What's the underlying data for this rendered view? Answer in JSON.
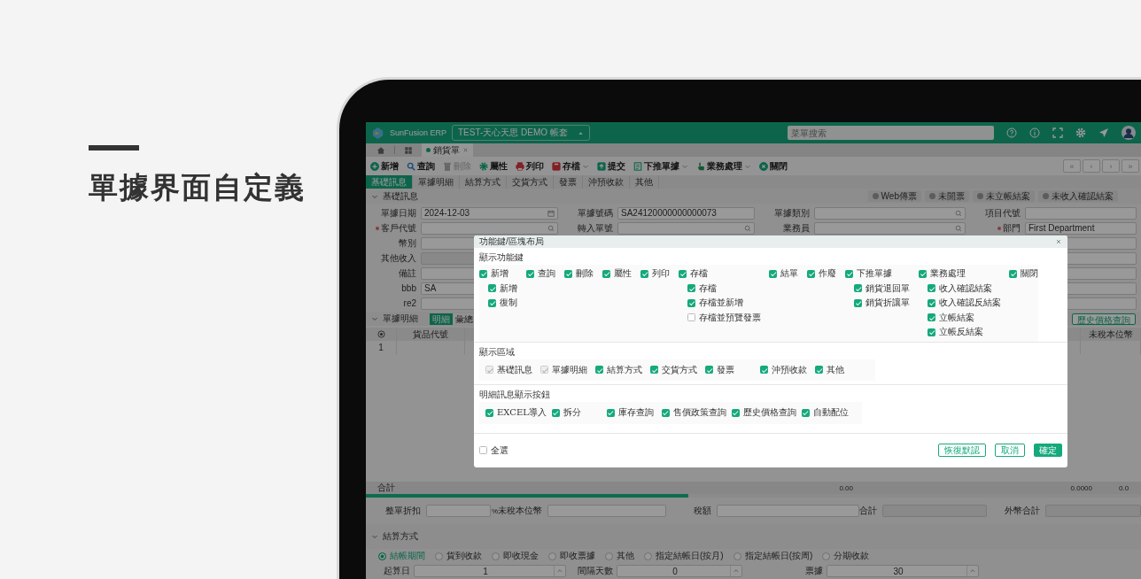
{
  "page": {
    "heading": "單據界面自定義"
  },
  "app": {
    "brand": "SunFusion ERP",
    "account": "TEST-天心天思 DEMO 帳套",
    "search": {
      "placeholder": "菜單搜索"
    },
    "doc_tabs": [
      {
        "label": "銷貨單",
        "selected": true
      }
    ],
    "toolbar": [
      {
        "label": "新增",
        "disabled": false,
        "dropdown": false
      },
      {
        "label": "查詢",
        "disabled": false,
        "dropdown": false
      },
      {
        "label": "刪除",
        "disabled": true,
        "dropdown": false
      },
      {
        "label": "屬性",
        "disabled": false,
        "dropdown": false
      },
      {
        "label": "列印",
        "disabled": false,
        "dropdown": false
      },
      {
        "label": "存檔",
        "disabled": false,
        "dropdown": true
      },
      {
        "label": "提交",
        "disabled": false,
        "dropdown": false
      },
      {
        "label": "下推單據",
        "disabled": false,
        "dropdown": true
      },
      {
        "label": "業務處理",
        "disabled": false,
        "dropdown": true
      },
      {
        "label": "關閉",
        "disabled": false,
        "dropdown": false
      }
    ],
    "pager": [
      "«",
      "‹",
      "›",
      "»"
    ],
    "section_tabs": [
      {
        "label": "基礎訊息",
        "selected": true
      },
      {
        "label": "單據明細",
        "selected": false
      },
      {
        "label": "結算方式",
        "selected": false
      },
      {
        "label": "交貨方式",
        "selected": false
      },
      {
        "label": "發票",
        "selected": false
      },
      {
        "label": "沖預收款",
        "selected": false
      },
      {
        "label": "其他",
        "selected": false
      }
    ],
    "basic_section": {
      "title": "基礎訊息",
      "actions": [
        "Web傳票",
        "未開票",
        "未立帳結案",
        "未收入確認結案"
      ]
    },
    "form_rows": [
      {
        "fields": [
          {
            "label": "單據日期",
            "value": "2024-12-03",
            "kind": "date",
            "required": false,
            "disabled": false
          },
          {
            "label": "單據號碼",
            "value": "SA24120000000000073",
            "kind": "text",
            "required": false,
            "disabled": false
          },
          {
            "label": "單據類別",
            "kind": "lookup",
            "required": false,
            "disabled": false
          },
          {
            "label": "項目代號",
            "kind": "text",
            "required": false,
            "disabled": false
          }
        ]
      },
      {
        "fields": [
          {
            "label": "客戶代號",
            "kind": "lookup",
            "required": true,
            "disabled": false
          },
          {
            "label": "轉入單號",
            "kind": "lookup",
            "required": false,
            "disabled": false
          },
          {
            "label": "業務員",
            "kind": "lookup",
            "required": false,
            "disabled": false
          },
          {
            "label": "部門",
            "value": "First Department",
            "kind": "text",
            "required": true,
            "disabled": false
          }
        ]
      },
      {
        "fields": [
          {
            "label": "幣別",
            "kind": "text",
            "required": false,
            "disabled": false
          },
          {
            "kind": "text",
            "disabled": false
          }
        ]
      },
      {
        "fields": [
          {
            "label": "其他收入",
            "kind": "text",
            "required": false,
            "disabled": true
          },
          {
            "kind": "text",
            "disabled": false
          }
        ]
      },
      {
        "fields": [
          {
            "label": "備註",
            "kind": "text",
            "required": false,
            "disabled": false
          },
          {
            "kind": "text",
            "disabled": false
          }
        ]
      },
      {
        "fields": [
          {
            "label": "bbb",
            "value": "SA",
            "kind": "text",
            "required": false,
            "disabled": false
          },
          {
            "kind": "text",
            "disabled": false
          }
        ]
      },
      {
        "fields": [
          {
            "label": "re2",
            "kind": "text",
            "required": false,
            "disabled": false
          },
          {
            "kind": "text",
            "disabled": false
          }
        ]
      }
    ],
    "detail_section": {
      "title": "單據明細",
      "views": [
        {
          "label": "明細",
          "selected": true
        },
        {
          "label": "彙總",
          "selected": false
        }
      ],
      "actions": [
        "歷史價格查詢"
      ]
    },
    "detail_table": {
      "columns": [
        "貨品代號",
        "未稅本位幣"
      ],
      "rows": [
        [
          "1"
        ]
      ]
    },
    "totals": {
      "label": "合計",
      "values": [
        "0.00",
        "0.0000",
        "0.0"
      ]
    },
    "summary_fields": [
      {
        "label": "整單折扣",
        "suffix": "%",
        "disabled": false
      },
      {
        "label": "未稅本位幣",
        "disabled": false
      },
      {
        "label": "稅額",
        "disabled": false
      },
      {
        "label": "合計",
        "disabled": true
      },
      {
        "label": "外幣合計",
        "disabled": true
      }
    ],
    "settlement": {
      "title": "結算方式",
      "options": [
        {
          "label": "結帳期間",
          "selected": true
        },
        {
          "label": "貨到收款",
          "selected": false
        },
        {
          "label": "即收現金",
          "selected": false
        },
        {
          "label": "即收票據",
          "selected": false
        },
        {
          "label": "其他",
          "selected": false
        },
        {
          "label": "指定結帳日(按月)",
          "selected": false
        },
        {
          "label": "指定結帳日(按周)",
          "selected": false
        },
        {
          "label": "分期收款",
          "selected": false
        }
      ],
      "fields": [
        {
          "label": "起算日",
          "value": "1"
        },
        {
          "label": "間隔天數",
          "value": "0"
        },
        {
          "label": "票據",
          "value": "30"
        }
      ]
    }
  },
  "dialog": {
    "title": "功能鍵/區塊布局",
    "sections": [
      {
        "title": "顯示功能鍵",
        "kind": "tree",
        "items": [
          {
            "label": "新增",
            "checked": true,
            "children": [
              {
                "label": "新增",
                "checked": true
              },
              {
                "label": "復制",
                "checked": true
              }
            ]
          },
          {
            "label": "查詢",
            "checked": true
          },
          {
            "label": "刪除",
            "checked": true
          },
          {
            "label": "屬性",
            "checked": true
          },
          {
            "label": "列印",
            "checked": true
          },
          {
            "label": "存檔",
            "checked": true,
            "children": [
              {
                "label": "存檔",
                "checked": true
              },
              {
                "label": "存檔並新增",
                "checked": true
              },
              {
                "label": "存檔並預覽發票",
                "checked": false
              }
            ]
          },
          {
            "label": "結單",
            "checked": true
          },
          {
            "label": "作廢",
            "checked": true
          },
          {
            "label": "下推單據",
            "checked": true,
            "children": [
              {
                "label": "銷貨退回單",
                "checked": true
              },
              {
                "label": "銷貨折讓單",
                "checked": true
              }
            ]
          },
          {
            "label": "業務處理",
            "checked": true,
            "children": [
              {
                "label": "收入確認結案",
                "checked": true
              },
              {
                "label": "收入確認反結案",
                "checked": true
              },
              {
                "label": "立帳結案",
                "checked": true
              },
              {
                "label": "立帳反結案",
                "checked": true
              }
            ]
          },
          {
            "label": "關閉",
            "checked": true
          }
        ]
      },
      {
        "title": "顯示區域",
        "kind": "flat",
        "items": [
          {
            "label": "基礎訊息",
            "checked": true,
            "disabled": true
          },
          {
            "label": "單據明細",
            "checked": true,
            "disabled": true
          },
          {
            "label": "結算方式",
            "checked": true,
            "disabled": false
          },
          {
            "label": "交貨方式",
            "checked": true,
            "disabled": false
          },
          {
            "label": "發票",
            "checked": true,
            "disabled": false
          },
          {
            "label": "沖預收款",
            "checked": true,
            "disabled": false
          },
          {
            "label": "其他",
            "checked": true,
            "disabled": false
          }
        ]
      },
      {
        "title": "明細訊息顯示按鈕",
        "kind": "flat",
        "items": [
          {
            "label": "EXCEL導入",
            "checked": true,
            "disabled": false
          },
          {
            "label": "拆分",
            "checked": true,
            "disabled": false
          },
          {
            "label": "庫存查詢",
            "checked": true,
            "disabled": false
          },
          {
            "label": "售價政策查詢",
            "checked": true,
            "disabled": false
          },
          {
            "label": "歷史價格查詢",
            "checked": true,
            "disabled": false
          },
          {
            "label": "自動配位",
            "checked": true,
            "disabled": false
          }
        ]
      }
    ],
    "select_all": {
      "label": "全選",
      "checked": false
    },
    "buttons": [
      {
        "label": "恢復默認",
        "kind": "outline"
      },
      {
        "label": "取消",
        "kind": "plain"
      },
      {
        "label": "確定",
        "kind": "primary"
      }
    ]
  }
}
